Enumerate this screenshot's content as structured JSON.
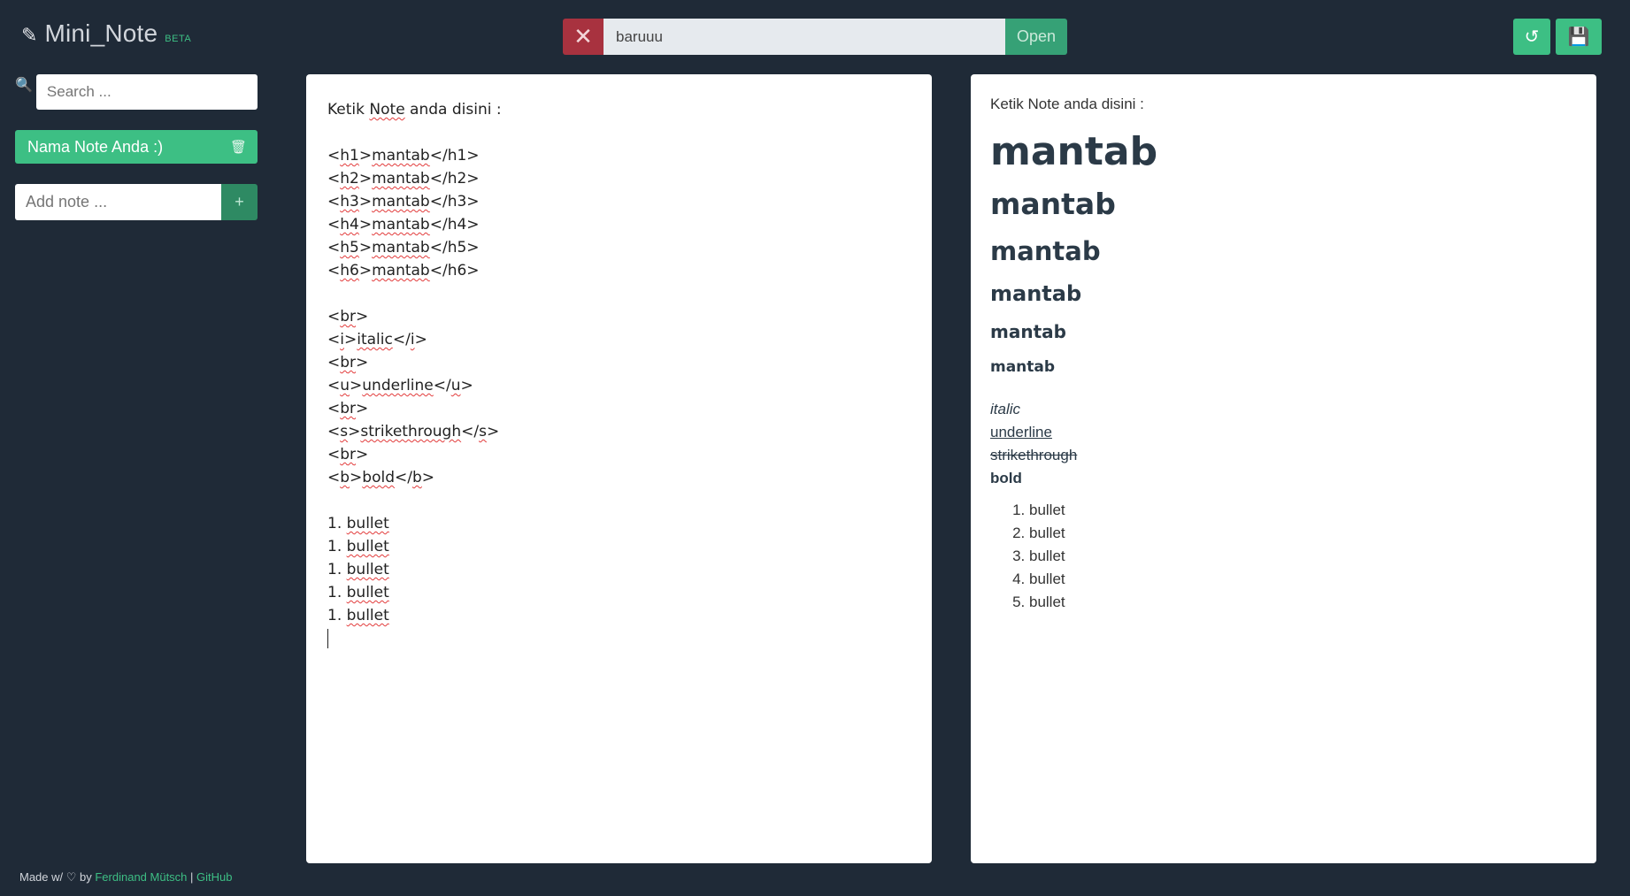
{
  "header": {
    "app_title": "Mini_Note",
    "beta_badge": "BETA",
    "filename_value": "baruuu",
    "close_glyph": "✕",
    "open_label": "Open",
    "reload_glyph": "↺",
    "save_glyph": "💾"
  },
  "sidebar": {
    "search_placeholder": "Search ...",
    "notes": [
      {
        "label": "Nama Note Anda :)"
      }
    ],
    "add_note_placeholder": "Add note ...",
    "add_button_label": "+"
  },
  "editor": {
    "intro_prefix": "Ketik ",
    "intro_word": "Note",
    "intro_suffix": " anda disini :"
  },
  "preview": {
    "intro": "Ketik Note anda disini :",
    "headings": [
      "mantab",
      "mantab",
      "mantab",
      "mantab",
      "mantab",
      "mantab"
    ],
    "italic": "italic",
    "underline": "underline",
    "strikethrough": "strikethrough",
    "bold": "bold",
    "bullets": [
      "bullet",
      "bullet",
      "bullet",
      "bullet",
      "bullet"
    ]
  },
  "footer": {
    "made_by_prefix": "Made w/ ♡ by ",
    "author": "Ferdinand Mütsch",
    "separator": " | ",
    "github": "GitHub"
  },
  "colors": {
    "background": "#1f2a37",
    "accent": "#3dbf84",
    "danger": "#a8323f"
  }
}
